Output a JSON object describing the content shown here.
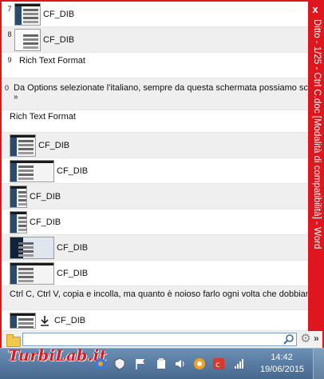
{
  "window": {
    "title": "Ditto - 1/25 - Ctrl C.doc [Modalità di compatibilità] - Word",
    "close_glyph": "x",
    "more_glyph": "»"
  },
  "clips": [
    {
      "num": "7",
      "type": "image",
      "label": "CF_DIB"
    },
    {
      "num": "8",
      "type": "image",
      "label": "CF_DIB"
    },
    {
      "num": "9",
      "type": "text",
      "label": "Rich Text Format"
    },
    {
      "num": "0",
      "type": "text",
      "label": "Da Options selezionate l'italiano, sempre da questa schermata possiamo sce",
      "extra": "»"
    },
    {
      "num": "",
      "type": "text",
      "label": "Rich Text Format"
    },
    {
      "num": "",
      "type": "image",
      "label": "CF_DIB"
    },
    {
      "num": "",
      "type": "image",
      "label": "CF_DIB"
    },
    {
      "num": "",
      "type": "image",
      "label": "CF_DIB"
    },
    {
      "num": "",
      "type": "image",
      "label": "CF_DIB"
    },
    {
      "num": "",
      "type": "image",
      "label": "CF_DIB"
    },
    {
      "num": "",
      "type": "image",
      "label": "CF_DIB"
    },
    {
      "num": "",
      "type": "text",
      "label": "Ctrl C, Ctrl V, copia e incolla, ma quanto è noioso farlo ogni volta che dobbiamo"
    },
    {
      "num": "",
      "type": "image",
      "label": "CF_DIB"
    }
  ],
  "search": {
    "value": "",
    "placeholder": ""
  },
  "taskbar": {
    "watermark": "TurbiLab.it",
    "time": "14:42",
    "date": "19/06/2015"
  },
  "icons": {
    "folder": "folder-icon",
    "search": "search-icon",
    "gear": "gear-icon",
    "download": "download-icon"
  },
  "colors": {
    "accent": "#e0161e",
    "taskbar": "#48698e",
    "row_alt": "#efefef"
  }
}
